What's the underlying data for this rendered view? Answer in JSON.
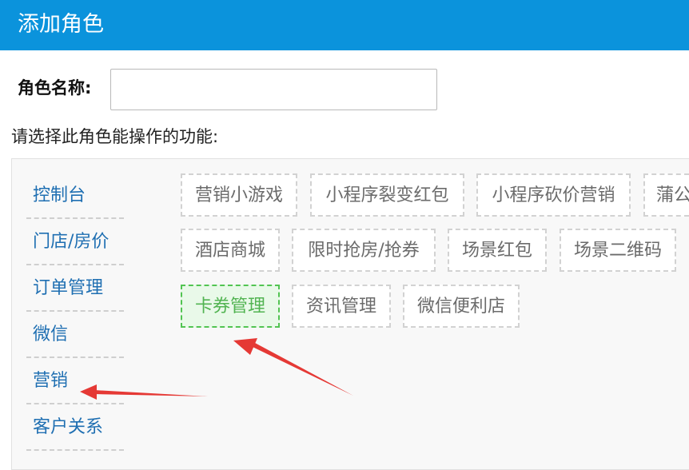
{
  "header": {
    "title": "添加角色"
  },
  "role_name": {
    "label": "角色名称:",
    "value": "",
    "placeholder": ""
  },
  "prompt": "请选择此角色能操作的功能:",
  "sidebar": {
    "items": [
      {
        "label": "控制台"
      },
      {
        "label": "门店/房价"
      },
      {
        "label": "订单管理"
      },
      {
        "label": "微信"
      },
      {
        "label": "营销"
      },
      {
        "label": "客户关系"
      }
    ]
  },
  "permissions": {
    "items": [
      {
        "label": "营销小游戏",
        "selected": false
      },
      {
        "label": "小程序裂变红包",
        "selected": false
      },
      {
        "label": "小程序砍价营销",
        "selected": false
      },
      {
        "label": "蒲公",
        "selected": false
      },
      {
        "label": "酒店商城",
        "selected": false
      },
      {
        "label": "限时抢房/抢券",
        "selected": false
      },
      {
        "label": "场景红包",
        "selected": false
      },
      {
        "label": "场景二维码",
        "selected": false
      },
      {
        "label": "卡券管理",
        "selected": true
      },
      {
        "label": "资讯管理",
        "selected": false
      },
      {
        "label": "微信便利店",
        "selected": false
      }
    ]
  },
  "colors": {
    "header_bg": "#0b93dc",
    "link_text": "#1f6fb2",
    "selected_border": "#52c452",
    "annotation_arrow": "#e53935"
  },
  "icons": {
    "annotation": "red-arrow-icon"
  }
}
